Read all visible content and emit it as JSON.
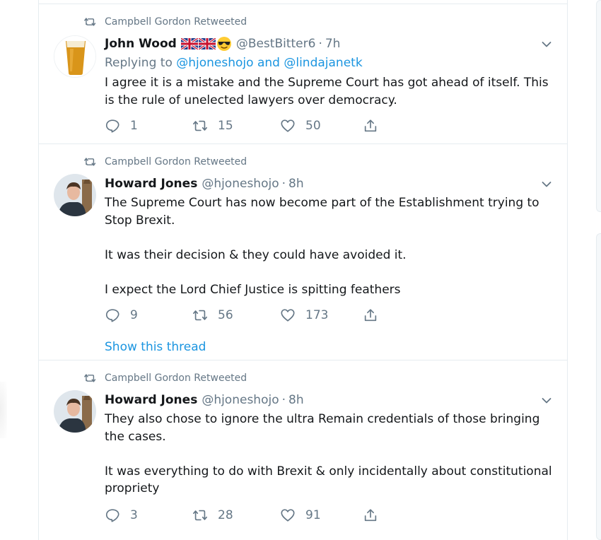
{
  "colors": {
    "link": "#1b95e0",
    "muted": "#657786",
    "text": "#14171a",
    "border": "#e6ecf0"
  },
  "tweets": [
    {
      "retweeted_by": "Campbell Gordon Retweeted",
      "name": "John Wood",
      "emoji": [
        "uk-flag",
        "uk-flag",
        "sunglasses-face"
      ],
      "handle": "@BestBitter6",
      "dot": "·",
      "time": "7h",
      "reply_prefix": "Replying to",
      "reply_user1": "@hjoneshojo",
      "reply_and": "and",
      "reply_user2": "@lindajanetk",
      "body": [
        "I agree it is a mistake and the Supreme Court has got ahead of itself. This is the rule of unelected lawyers over democracy."
      ],
      "replies": "1",
      "retweets": "15",
      "likes": "50"
    },
    {
      "retweeted_by": "Campbell Gordon Retweeted",
      "name": "Howard Jones",
      "handle": "@hjoneshojo",
      "dot": "·",
      "time": "8h",
      "body": [
        "The Supreme Court has now become part of the Establishment trying to Stop Brexit.",
        "It was their decision & they could have avoided it.",
        "I expect the Lord Chief Justice is spitting feathers"
      ],
      "replies": "9",
      "retweets": "56",
      "likes": "173",
      "show_thread": "Show this thread"
    },
    {
      "retweeted_by": "Campbell Gordon Retweeted",
      "name": "Howard Jones",
      "handle": "@hjoneshojo",
      "dot": "·",
      "time": "8h",
      "body": [
        "They also chose to ignore the ultra Remain credentials of those bringing the cases.",
        "It was everything to do with Brexit & only incidentally about constitutional propriety"
      ],
      "replies": "3",
      "retweets": "28",
      "likes": "91"
    }
  ]
}
